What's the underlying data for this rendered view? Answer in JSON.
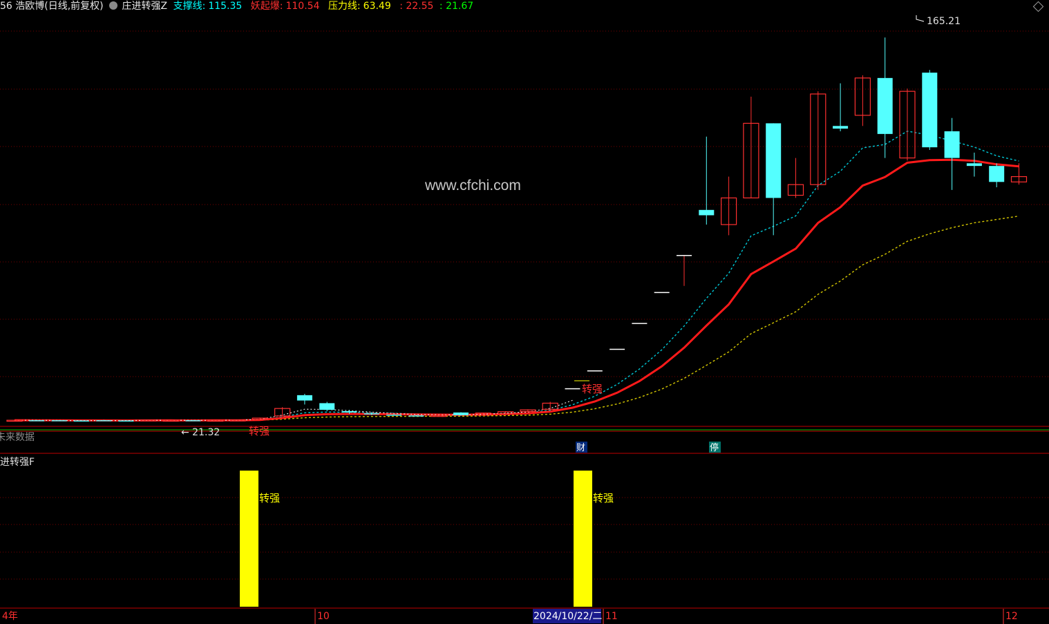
{
  "header": {
    "stock": "56 浩欧博(日线,前复权)",
    "indicator": "庄进转强Z",
    "items": [
      {
        "label": "支撑线:",
        "value": "115.35",
        "color": "#00ffff"
      },
      {
        "label": "妖起爆:",
        "value": "110.54",
        "color": "#ff3030"
      },
      {
        "label": "压力线:",
        "value": "63.49",
        "color": "#ffff00"
      },
      {
        "label": "",
        "value": ": 22.55",
        "color": "#ff3030"
      },
      {
        "label": "",
        "value": ": 21.67",
        "color": "#00ff00"
      }
    ],
    "corner_icon": "diamond-icon"
  },
  "watermark": "www.cfchi.com",
  "main_panel": {
    "high_label": "165.21",
    "low_label": "← 21.32",
    "future_data_label": "未来数据",
    "signal_labels": [
      "转强",
      "转强"
    ],
    "event_tags": [
      "财",
      "停"
    ]
  },
  "sub_panel": {
    "title": "进转强F",
    "bar_labels": [
      "转强",
      "转强"
    ]
  },
  "time_axis": {
    "labels": [
      "4年",
      "10",
      "11",
      "12"
    ],
    "selected_date": "2024/10/22/二"
  },
  "colors": {
    "up": "#ff3030",
    "down": "#54ffff",
    "grid": "#8b0000",
    "ma_cyan": "#00c8d6",
    "ma_red": "#ff1a1a",
    "ma_yellow": "#d6c800",
    "signal_bar": "#ffff00"
  },
  "chart_data": {
    "type": "candlestick",
    "series_note": "daily OHLC, estimated from pixels",
    "candles": [
      [
        21.5,
        21.6,
        21.7,
        21.3
      ],
      [
        21.6,
        21.5,
        21.7,
        21.3
      ],
      [
        21.6,
        21.4,
        21.6,
        21.32
      ],
      [
        21.5,
        21.4,
        21.6,
        21.3
      ],
      [
        21.6,
        21.5,
        21.7,
        21.4
      ],
      [
        21.5,
        21.4,
        21.6,
        21.3
      ],
      [
        21.6,
        21.7,
        21.8,
        21.5
      ],
      [
        21.5,
        21.6,
        21.7,
        21.4
      ],
      [
        21.6,
        21.5,
        21.7,
        21.4
      ],
      [
        21.5,
        21.6,
        21.7,
        21.4
      ],
      [
        21.6,
        21.7,
        21.8,
        21.5
      ],
      [
        21.9,
        22.4,
        22.6,
        21.8
      ],
      [
        23.2,
        26.0,
        26.5,
        23.0
      ],
      [
        31.0,
        29.0,
        31.5,
        27.5
      ],
      [
        28.0,
        25.5,
        28.5,
        25.0
      ],
      [
        25.0,
        24.5,
        25.5,
        24.0
      ],
      [
        24.2,
        23.8,
        24.5,
        23.5
      ],
      [
        23.7,
        23.5,
        23.9,
        23.3
      ],
      [
        23.4,
        23.2,
        23.6,
        23.1
      ],
      [
        23.2,
        23.4,
        23.6,
        23.0
      ],
      [
        24.5,
        23.5,
        24.6,
        23.3
      ],
      [
        23.5,
        24.3,
        24.5,
        23.2
      ],
      [
        24.0,
        24.8,
        25.0,
        23.9
      ],
      [
        24.9,
        25.5,
        25.7,
        24.8
      ],
      [
        25.7,
        28.0,
        28.5,
        25.6
      ],
      [
        33.6,
        33.6,
        33.6,
        33.6
      ],
      [
        40.3,
        40.3,
        40.3,
        40.3
      ],
      [
        48.4,
        48.4,
        48.4,
        48.4
      ],
      [
        58.1,
        58.1,
        58.1,
        58.1
      ],
      [
        69.7,
        69.7,
        69.7,
        69.7
      ],
      [
        83.6,
        83.6,
        83.6,
        72.0
      ],
      [
        100.5,
        98.5,
        128.0,
        95.0
      ],
      [
        95.0,
        105.0,
        113.0,
        91.0
      ],
      [
        105.0,
        133.0,
        143.0,
        105.0
      ],
      [
        133.0,
        105.0,
        133.0,
        91.0
      ],
      [
        106.0,
        110.0,
        120.0,
        105.0
      ],
      [
        110.0,
        144.0,
        145.0,
        108.0
      ],
      [
        132.0,
        131.0,
        148.0,
        130.0
      ],
      [
        136.0,
        150.0,
        151.0,
        132.0
      ],
      [
        150.0,
        129.0,
        165.21,
        120.0
      ],
      [
        120.0,
        145.0,
        146.0,
        119.0
      ],
      [
        152.0,
        124.0,
        153.0,
        123.0
      ],
      [
        130.0,
        120.0,
        135.0,
        108.0
      ],
      [
        118.0,
        117.0,
        122.0,
        113.0
      ],
      [
        117.0,
        111.0,
        118.0,
        109.0
      ],
      [
        111.0,
        113.0,
        118.0,
        110.0
      ]
    ],
    "series": [
      {
        "name": "支撑线",
        "last": 115.35
      },
      {
        "name": "妖起爆",
        "last": 110.54
      },
      {
        "name": "压力线",
        "last": 63.49
      }
    ],
    "signals_at_index": [
      11,
      26
    ],
    "y_range": [
      18,
      172
    ]
  }
}
